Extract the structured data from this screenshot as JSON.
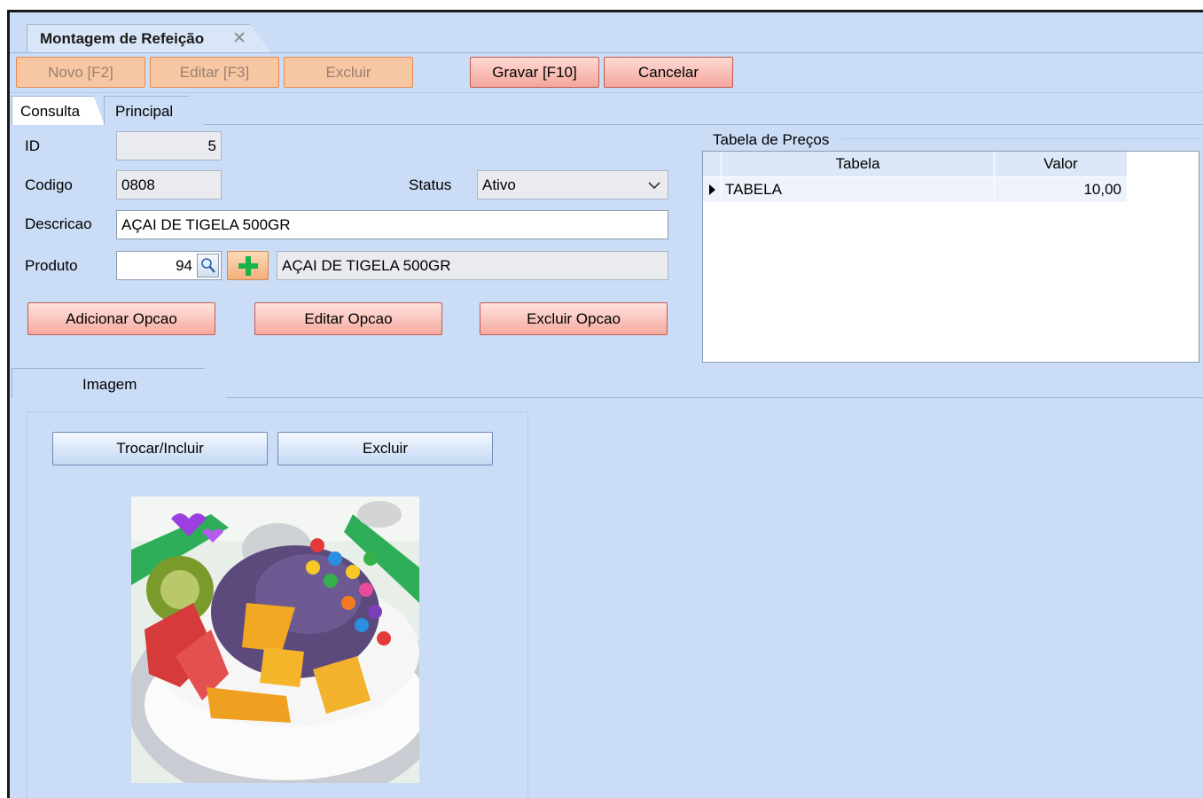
{
  "window": {
    "tab_title": "Montagem de Refeição",
    "close_glyph": "✕"
  },
  "toolbar": {
    "novo": "Novo [F2]",
    "editar": "Editar [F3]",
    "excluir": "Excluir",
    "gravar": "Gravar [F10]",
    "cancelar": "Cancelar"
  },
  "tabs": {
    "consulta": "Consulta",
    "principal": "Principal"
  },
  "form": {
    "id_label": "ID",
    "id_value": "5",
    "codigo_label": "Codigo",
    "codigo_value": "0808",
    "status_label": "Status",
    "status_value": "Ativo",
    "descricao_label": "Descricao",
    "descricao_value": "AÇAI DE TIGELA 500GR",
    "produto_label": "Produto",
    "produto_code": "94",
    "produto_name": "AÇAI DE TIGELA 500GR"
  },
  "options_buttons": {
    "adicionar": "Adicionar Opcao",
    "editar": "Editar Opcao",
    "excluir": "Excluir Opcao"
  },
  "price_table": {
    "title": "Tabela de Preços",
    "columns": [
      "Tabela",
      "Valor"
    ],
    "rows": [
      {
        "tabela": "TABELA",
        "valor": "10,00"
      }
    ]
  },
  "image_section": {
    "tab_label": "Imagem",
    "trocar": "Trocar/Incluir",
    "excluir": "Excluir",
    "image_icon": "acai-bowl-photo"
  },
  "colors": {
    "background": "#cbdcf6",
    "disabled_button": "#f7c7a3",
    "action_button": "#f3a79d",
    "blue_button": "#c3d8f3"
  }
}
